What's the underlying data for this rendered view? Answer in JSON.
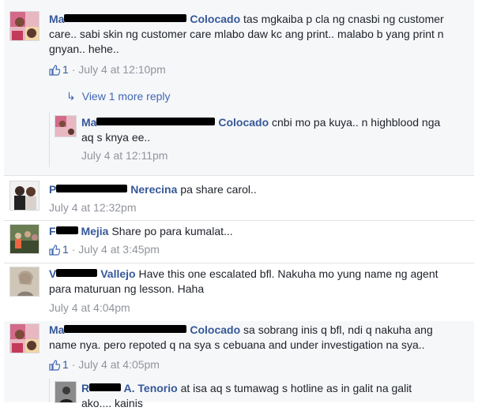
{
  "comments": [
    {
      "name_visible": "Colocado",
      "text": "tas mgkaiba p cla ng cnasbi ng customer care.. sabi skin ng customer care mlabo daw kc ang print.. malabo b yang print n gnyan.. hehe..",
      "likes": "1",
      "time": "July 4 at 12:10pm"
    },
    {
      "name_visible": "Colocado",
      "text": "cnbi mo pa kuya.. n highblood nga aq s knya ee..",
      "time": "July 4 at 12:11pm"
    },
    {
      "name_visible": "Nerecina",
      "text": "pa share carol..",
      "time": "July 4 at 12:32pm"
    },
    {
      "name_visible": "Mejia",
      "text": "Share po para kumalat...",
      "likes": "1",
      "time": "July 4 at 3:45pm"
    },
    {
      "name_visible": "Vallejo",
      "text": "Have this one escalated bfl. Nakuha mo yung name ng agent para maturuan ng lesson. Haha",
      "time": "July 4 at 4:04pm"
    },
    {
      "name_visible": "Colocado",
      "text": "sa sobrang inis q bfl, ndi q nakuha ang name nya. pero repoted q na sya s cebuana and under investigation na sya..",
      "likes": "1",
      "time": "July 4 at 4:05pm"
    },
    {
      "name_visible": "A. Tenorio",
      "text": "at isa aq s tumawag s hotline as in galit na galit ako.... kainis"
    }
  ],
  "view_replies_label": "View 1 more reply",
  "separator": "·",
  "colors": {
    "name": "#365899",
    "meta": "#90949c",
    "background": "#f6f7f9"
  }
}
